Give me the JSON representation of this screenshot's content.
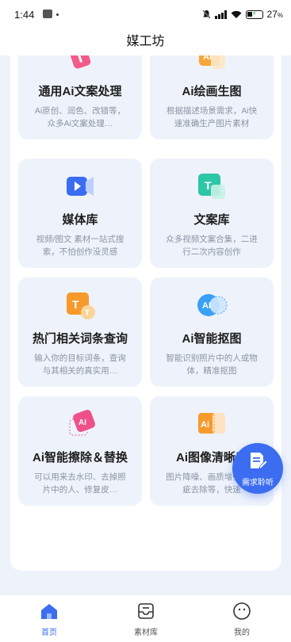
{
  "status_bar": {
    "time": "1:44",
    "battery": "27",
    "battery_unit": "%"
  },
  "header": {
    "title": "媒工坊"
  },
  "cards": [
    {
      "title": "通用Ai文案处理",
      "desc": "Ai原创、润色、改错等，众多Ai文案处理…",
      "icon": "text-ai-icon"
    },
    {
      "title": "Ai绘画生图",
      "desc": "根据描述场景需求，Ai快速准确生产图片素材",
      "icon": "ai-paint-icon"
    },
    {
      "title": "媒体库",
      "desc": "视频/图文 素材一站式搜索，不怕创作没灵感",
      "icon": "video-camera-icon"
    },
    {
      "title": "文案库",
      "desc": "众多视频文案合集，二进行二次内容创作",
      "icon": "text-library-icon"
    },
    {
      "title": "热门相关词条查询",
      "desc": "输入你的目标词条，查询与其相关的真实用…",
      "icon": "hot-words-icon"
    },
    {
      "title": "Ai智能抠图",
      "desc": "智能识别照片中的人或物体，精准抠图",
      "icon": "ai-cutout-icon"
    },
    {
      "title": "Ai智能擦除＆替换",
      "desc": "可以用来去水印、去掉照片中的人、修复皮…",
      "icon": "ai-erase-icon"
    },
    {
      "title": "Ai图像清晰度",
      "desc": "图片降噪、画质增强、瑕疵去除等，快速",
      "icon": "ai-enhance-icon"
    }
  ],
  "fab": {
    "label": "需求聆听",
    "icon": "document-edit-icon"
  },
  "tabs": [
    {
      "label": "首页",
      "icon": "home-icon",
      "active": true
    },
    {
      "label": "素材库",
      "icon": "inbox-icon",
      "active": false
    },
    {
      "label": "我的",
      "icon": "smile-icon",
      "active": false
    }
  ],
  "colors": {
    "accent": "#3c6df0",
    "card_bg": "#eef3fb",
    "page_bg": "#edf2fb"
  }
}
